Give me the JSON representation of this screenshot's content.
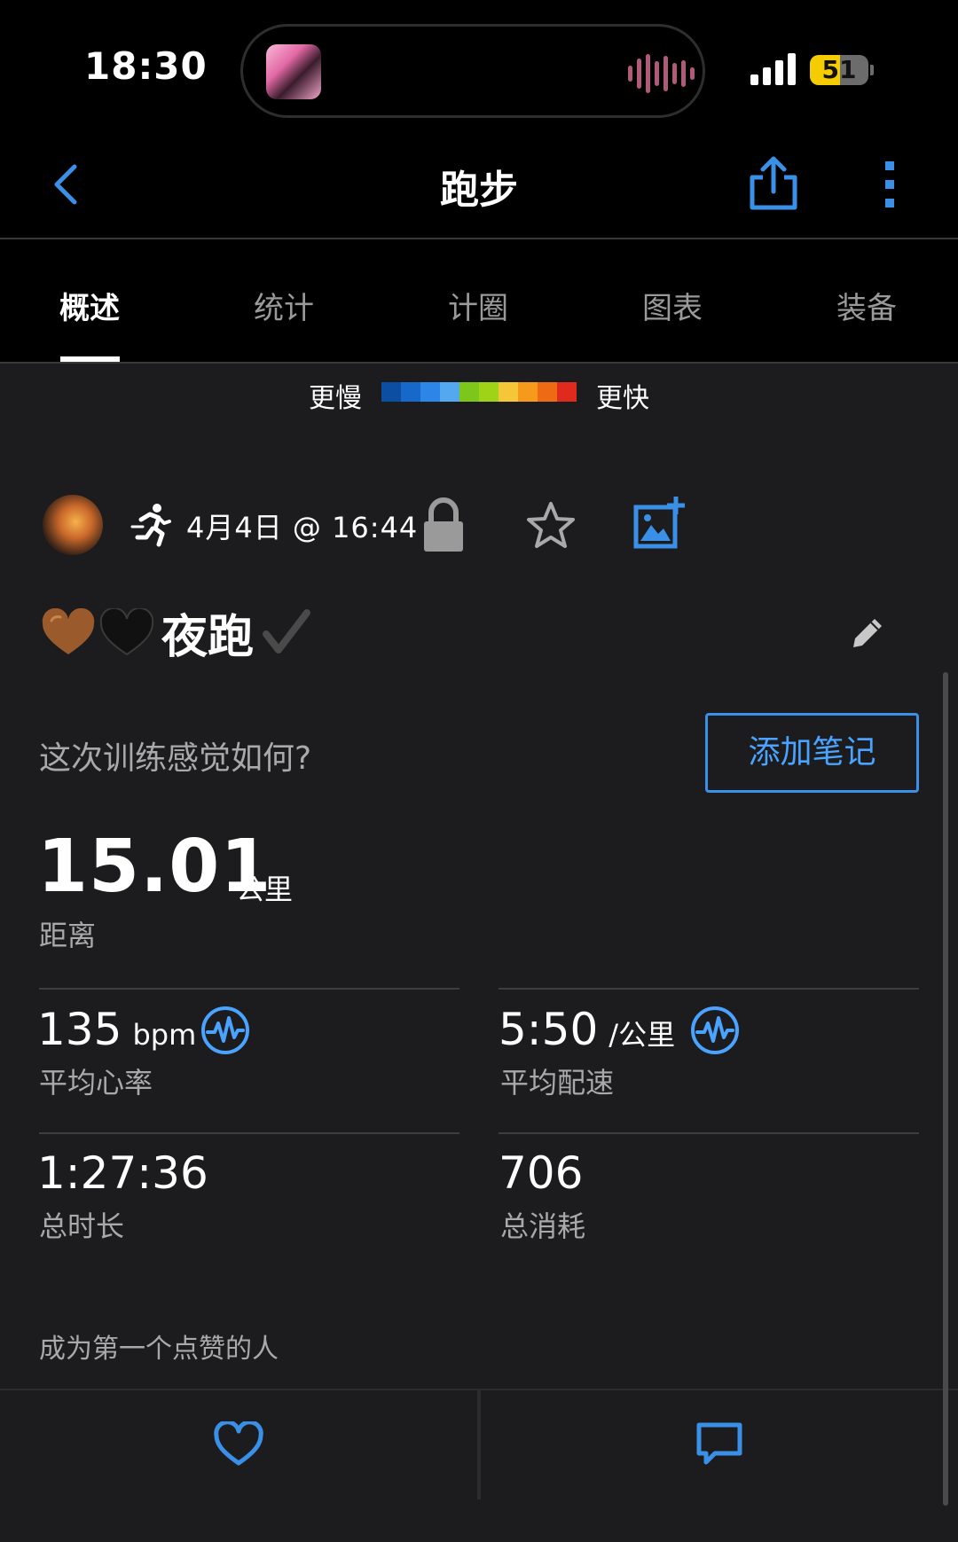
{
  "status_bar": {
    "time": "18:30",
    "battery_level": 51,
    "battery_text": "51"
  },
  "nav": {
    "title": "跑步",
    "back_icon": "chevron-left-icon",
    "share_icon": "share-icon",
    "more_icon": "more-vertical-icon"
  },
  "tabs": [
    {
      "label": "概述",
      "active": true
    },
    {
      "label": "统计",
      "active": false
    },
    {
      "label": "计圈",
      "active": false
    },
    {
      "label": "图表",
      "active": false
    },
    {
      "label": "装备",
      "active": false
    }
  ],
  "pace_legend": {
    "slow_label": "更慢",
    "fast_label": "更快",
    "colors": [
      "#0b4ea2",
      "#1668c9",
      "#2b86e8",
      "#54a8f0",
      "#7cc71a",
      "#9fd318",
      "#f5c638",
      "#f59a1b",
      "#ee6a14",
      "#e12a1e"
    ]
  },
  "activity": {
    "date_time": "4月4日 @ 16:44",
    "name": "夜跑",
    "feel_question": "这次训练感觉如何?",
    "add_note_label": "添加笔记"
  },
  "stats": {
    "distance": {
      "value": "15.01",
      "unit": "公里",
      "label": "距离"
    },
    "avg_hr": {
      "value": "135",
      "unit": "bpm",
      "label": "平均心率"
    },
    "avg_pace": {
      "value": "5:50",
      "unit": "/公里",
      "label": "平均配速"
    },
    "duration": {
      "value": "1:27:36",
      "label": "总时长"
    },
    "calories": {
      "value": "706",
      "label": "总消耗"
    }
  },
  "social": {
    "likes_prompt": "成为第一个点赞的人"
  },
  "colors": {
    "accent": "#3a8fe6",
    "panel_bg": "#1c1c1e",
    "secondary_text": "#a9a9a9"
  }
}
